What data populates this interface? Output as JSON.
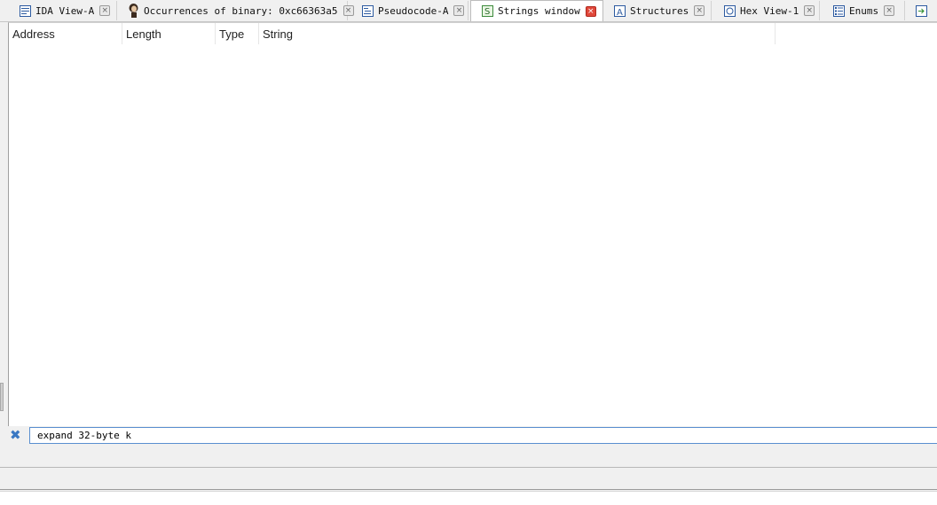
{
  "tabs": [
    {
      "label": "IDA View-A",
      "icon": "ida-view-icon",
      "close": "×"
    },
    {
      "label": "Occurrences of binary: 0xc66363a5",
      "icon": "search-person-icon",
      "close": "×"
    },
    {
      "label": "Pseudocode-A",
      "icon": "pseudocode-icon",
      "close": "×"
    },
    {
      "label": "Strings window",
      "icon": "strings-icon",
      "close": "×"
    },
    {
      "label": "Structures",
      "icon": "structures-icon",
      "close": "×"
    },
    {
      "label": "Hex View-1",
      "icon": "hex-view-icon",
      "close": "×"
    },
    {
      "label": "Enums",
      "icon": "enums-icon",
      "close": "×"
    }
  ],
  "table": {
    "columns": [
      "Address",
      "Length",
      "Type",
      "String"
    ],
    "rows": []
  },
  "filter": {
    "value": "expand 32-byte k",
    "clear_glyph": "✖"
  },
  "colors": {
    "active_close": "#e0483a",
    "filter_border": "#5a8fd0",
    "clear_icon": "#3a78c3"
  }
}
